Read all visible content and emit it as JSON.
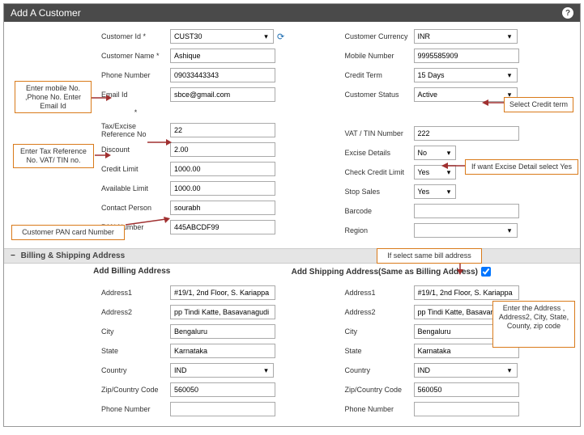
{
  "header": {
    "title": "Add A Customer"
  },
  "left": {
    "customer_id_lbl": "Customer Id *",
    "customer_id": "CUST30",
    "customer_name_lbl": "Customer Name *",
    "customer_name": "Ashique",
    "phone_lbl": "Phone Number",
    "phone": "09033443343",
    "email_lbl": "Email Id",
    "email_star": "*",
    "email": "sbce@gmail.com",
    "tax_lbl": "Tax/Excise Reference No",
    "tax": "22",
    "discount_lbl": "Discount",
    "discount": "2.00",
    "credit_limit_lbl": "Credit Limit",
    "credit_limit": "1000.00",
    "avail_limit_lbl": "Available Limit",
    "avail_limit": "1000.00",
    "contact_lbl": "Contact Person",
    "contact": "sourabh",
    "pan_lbl": "PAN Number",
    "pan": "445ABCDF99"
  },
  "right": {
    "currency_lbl": "Customer Currency",
    "currency": "INR",
    "mobile_lbl": "Mobile Number",
    "mobile": "9995585909",
    "credit_term_lbl": "Credit Term",
    "credit_term": "15 Days",
    "status_lbl": "Customer Status",
    "status": "Active",
    "vat_lbl": "VAT / TIN Number",
    "vat": "222",
    "excise_lbl": "Excise Details",
    "excise": "No",
    "check_credit_lbl": "Check Credit Limit",
    "check_credit": "Yes",
    "stop_sales_lbl": "Stop Sales",
    "stop_sales": "Yes",
    "barcode_lbl": "Barcode",
    "barcode": "",
    "region_lbl": "Region",
    "region": ""
  },
  "section": {
    "title": "Billing & Shipping Address"
  },
  "addr_heads": {
    "billing": "Add Billing Address",
    "shipping": "Add Shipping Address(Same as Billing Address)"
  },
  "addr": {
    "addr1_lbl": "Address1",
    "addr2_lbl": "Address2",
    "city_lbl": "City",
    "state_lbl": "State",
    "country_lbl": "Country",
    "zip_lbl": "Zip/Country Code",
    "phone_lbl": "Phone Number",
    "b_addr1": "#19/1, 2nd Floor, S. Kariappa",
    "b_addr2": "pp Tindi Katte, Basavanagudi",
    "b_city": "Bengaluru",
    "b_state": "Karnataka",
    "b_country": "IND",
    "b_zip": "560050",
    "b_phone": "",
    "s_addr1": "#19/1, 2nd Floor, S. Kariappa",
    "s_addr2": "pp Tindi Katte, Basavanagudi",
    "s_city": "Bengaluru",
    "s_state": "Karnataka",
    "s_country": "IND",
    "s_zip": "560050",
    "s_phone": ""
  },
  "annotations": {
    "mobile_email": "Enter mobile No. ,Phone No. Enter Email Id",
    "tax_vat": "Enter Tax Reference No. VAT/ TIN no.",
    "pan": "Customer PAN card Number",
    "credit_term": "Select Credit term",
    "excise": "If want Excise Detail select Yes",
    "same_addr": "If select same bill address",
    "address": "Enter the Address , Address2, City, State, County, zip code"
  },
  "icons": {
    "caret": "▾",
    "refresh": "⟳",
    "help": "?",
    "collapse": "−",
    "check": "✓"
  }
}
